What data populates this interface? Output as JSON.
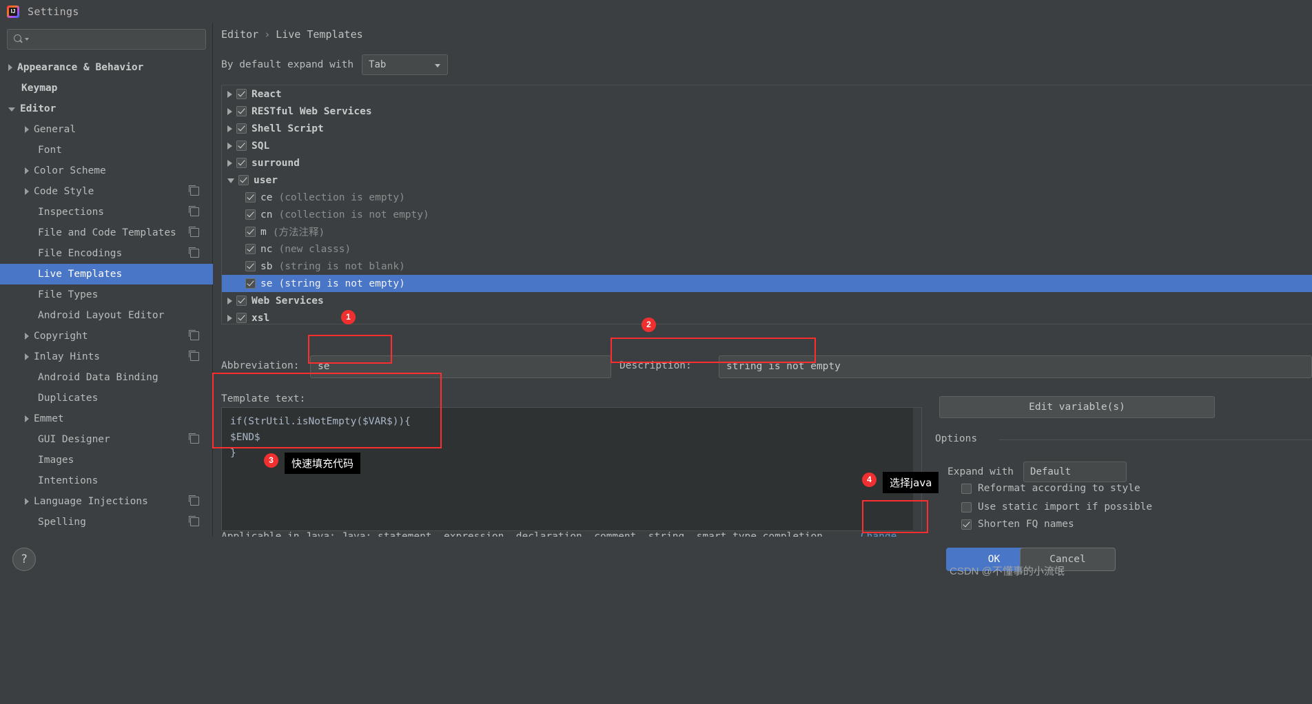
{
  "window": {
    "title": "Settings",
    "logo_text": "IJ"
  },
  "search": {
    "value": "",
    "placeholder": ""
  },
  "sidebar": {
    "items": [
      {
        "label": "Appearance & Behavior",
        "indent": 0,
        "arrow": "right",
        "bold": true,
        "copy": false,
        "selected": false
      },
      {
        "label": "Keymap",
        "indent": 0,
        "arrow": "none",
        "bold": true,
        "copy": false,
        "selected": false
      },
      {
        "label": "Editor",
        "indent": 0,
        "arrow": "down",
        "bold": true,
        "copy": false,
        "selected": false
      },
      {
        "label": "General",
        "indent": 1,
        "arrow": "right",
        "bold": false,
        "copy": false,
        "selected": false
      },
      {
        "label": "Font",
        "indent": 1,
        "arrow": "none",
        "bold": false,
        "copy": false,
        "selected": false
      },
      {
        "label": "Color Scheme",
        "indent": 1,
        "arrow": "right",
        "bold": false,
        "copy": false,
        "selected": false
      },
      {
        "label": "Code Style",
        "indent": 1,
        "arrow": "right",
        "bold": false,
        "copy": true,
        "selected": false
      },
      {
        "label": "Inspections",
        "indent": 1,
        "arrow": "none",
        "bold": false,
        "copy": true,
        "selected": false
      },
      {
        "label": "File and Code Templates",
        "indent": 1,
        "arrow": "none",
        "bold": false,
        "copy": true,
        "selected": false
      },
      {
        "label": "File Encodings",
        "indent": 1,
        "arrow": "none",
        "bold": false,
        "copy": true,
        "selected": false
      },
      {
        "label": "Live Templates",
        "indent": 1,
        "arrow": "none",
        "bold": false,
        "copy": false,
        "selected": true
      },
      {
        "label": "File Types",
        "indent": 1,
        "arrow": "none",
        "bold": false,
        "copy": false,
        "selected": false
      },
      {
        "label": "Android Layout Editor",
        "indent": 1,
        "arrow": "none",
        "bold": false,
        "copy": false,
        "selected": false
      },
      {
        "label": "Copyright",
        "indent": 1,
        "arrow": "right",
        "bold": false,
        "copy": true,
        "selected": false
      },
      {
        "label": "Inlay Hints",
        "indent": 1,
        "arrow": "right",
        "bold": false,
        "copy": true,
        "selected": false
      },
      {
        "label": "Android Data Binding",
        "indent": 1,
        "arrow": "none",
        "bold": false,
        "copy": false,
        "selected": false
      },
      {
        "label": "Duplicates",
        "indent": 1,
        "arrow": "none",
        "bold": false,
        "copy": false,
        "selected": false
      },
      {
        "label": "Emmet",
        "indent": 1,
        "arrow": "right",
        "bold": false,
        "copy": false,
        "selected": false
      },
      {
        "label": "GUI Designer",
        "indent": 1,
        "arrow": "none",
        "bold": false,
        "copy": true,
        "selected": false
      },
      {
        "label": "Images",
        "indent": 1,
        "arrow": "none",
        "bold": false,
        "copy": false,
        "selected": false
      },
      {
        "label": "Intentions",
        "indent": 1,
        "arrow": "none",
        "bold": false,
        "copy": false,
        "selected": false
      },
      {
        "label": "Language Injections",
        "indent": 1,
        "arrow": "right",
        "bold": false,
        "copy": true,
        "selected": false
      },
      {
        "label": "Spelling",
        "indent": 1,
        "arrow": "none",
        "bold": false,
        "copy": true,
        "selected": false
      }
    ]
  },
  "breadcrumb": {
    "parent": "Editor",
    "separator": "›",
    "current": "Live Templates"
  },
  "expand": {
    "label": "By default expand with",
    "value": "Tab"
  },
  "templates": [
    {
      "kind": "group",
      "arrow": "right",
      "label": "React",
      "checked": true
    },
    {
      "kind": "group",
      "arrow": "right",
      "label": "RESTful Web Services",
      "checked": true
    },
    {
      "kind": "group",
      "arrow": "right",
      "label": "Shell Script",
      "checked": true
    },
    {
      "kind": "group",
      "arrow": "right",
      "label": "SQL",
      "checked": true
    },
    {
      "kind": "group",
      "arrow": "right",
      "label": "surround",
      "checked": true
    },
    {
      "kind": "group",
      "arrow": "down",
      "label": "user",
      "checked": true
    },
    {
      "kind": "item",
      "abbr": "ce",
      "desc": "(collection is empty)",
      "checked": true,
      "selected": false
    },
    {
      "kind": "item",
      "abbr": "cn",
      "desc": "(collection is not empty)",
      "checked": true,
      "selected": false
    },
    {
      "kind": "item",
      "abbr": "m",
      "desc": "(方法注释)",
      "checked": true,
      "selected": false
    },
    {
      "kind": "item",
      "abbr": "nc",
      "desc": "(new classs)",
      "checked": true,
      "selected": false
    },
    {
      "kind": "item",
      "abbr": "sb",
      "desc": "(string is not blank)",
      "checked": true,
      "selected": false
    },
    {
      "kind": "item",
      "abbr": "se",
      "desc": "(string is not empty)",
      "checked": true,
      "selected": true
    },
    {
      "kind": "group",
      "arrow": "right",
      "label": "Web Services",
      "checked": true
    },
    {
      "kind": "group",
      "arrow": "right",
      "label": "xsl",
      "checked": true
    }
  ],
  "fields": {
    "abbreviation_label": "Abbreviation:",
    "abbreviation_value": "se",
    "description_label": "Description:",
    "description_value": "string is not empty"
  },
  "template_text": {
    "label": "Template text:",
    "code": "if(StrUtil.isNotEmpty($VAR$)){\n$END$\n}"
  },
  "right_panel": {
    "edit_variables": "Edit variable(s)",
    "options_title": "Options",
    "expand_with_label": "Expand with",
    "expand_with_value": "Default",
    "checkboxes": [
      {
        "label": "Reformat according to style",
        "checked": false
      },
      {
        "label": "Use static import if possible",
        "checked": false
      },
      {
        "label": "Shorten FQ names",
        "checked": true
      }
    ]
  },
  "applicable": {
    "text": "Applicable in Java; Java: statement, expression, declaration, comment, string, smart type completion.",
    "dot": ".",
    "change_label": "Change"
  },
  "bottom": {
    "help": "?",
    "ok": "OK",
    "cancel": "Cancel",
    "watermark": "CSDN @不懂事的小流氓"
  },
  "annotations": [
    {
      "badge": "1",
      "note": ""
    },
    {
      "badge": "2",
      "note": ""
    },
    {
      "badge": "3",
      "note": "快速填充代码"
    },
    {
      "badge": "4",
      "note": "选择java"
    }
  ],
  "colors": {
    "accent": "#4a76c8",
    "annotation": "#ff2d2d",
    "link": "#5b9bd5",
    "panel": "#3c3f41"
  }
}
